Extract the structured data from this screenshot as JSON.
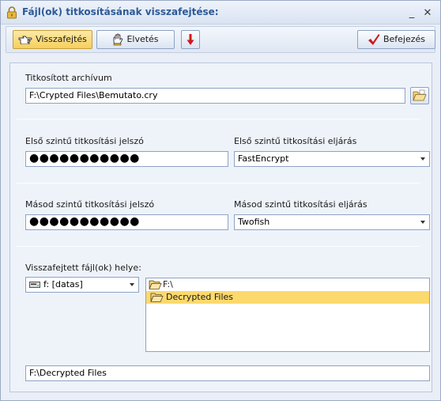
{
  "window": {
    "title": "Fájl(ok) titkosításának visszafejtése:"
  },
  "titlebar": {
    "minimize": "_",
    "close": "✕"
  },
  "toolbar": {
    "decrypt_label": "Visszafejtés",
    "discard_label": "Elvetés",
    "finish_label": "Befejezés"
  },
  "archive": {
    "label": "Titkosított archívum",
    "value": "F:\\Crypted Files\\Bemutato.cry"
  },
  "level1": {
    "password_label": "Első szintű titkosítási jelszó",
    "password_value": "●●●●●●●●●●●",
    "method_label": "Első szintű titkosítási eljárás",
    "method_value": "FastEncrypt"
  },
  "level2": {
    "password_label": "Másod szintű titkosítási jelszó",
    "password_value": "●●●●●●●●●●●",
    "method_label": "Másod szintű titkosítási eljárás",
    "method_value": "Twofish"
  },
  "output": {
    "label": "Visszafejtett fájl(ok) helye:",
    "drive_value": "f: [datas]",
    "tree": [
      {
        "label": "F:\\",
        "selected": false
      },
      {
        "label": "Decrypted Files",
        "selected": true
      }
    ],
    "path_value": "F:\\Decrypted Files"
  },
  "colors": {
    "active_button": "#f6cf5c",
    "selection": "#fcd96d",
    "title_text": "#2d5a96",
    "finish_check": "#d01818",
    "down_arrow": "#d01818"
  },
  "icons": {
    "title": "lock-icon",
    "decrypt": "pointing-hand-icon",
    "discard": "stop-hand-icon",
    "move_down": "down-arrow-icon",
    "finish": "checkmark-icon",
    "browse": "open-folder-icon",
    "drive": "drive-icon",
    "folder_open": "folder-open-icon"
  }
}
